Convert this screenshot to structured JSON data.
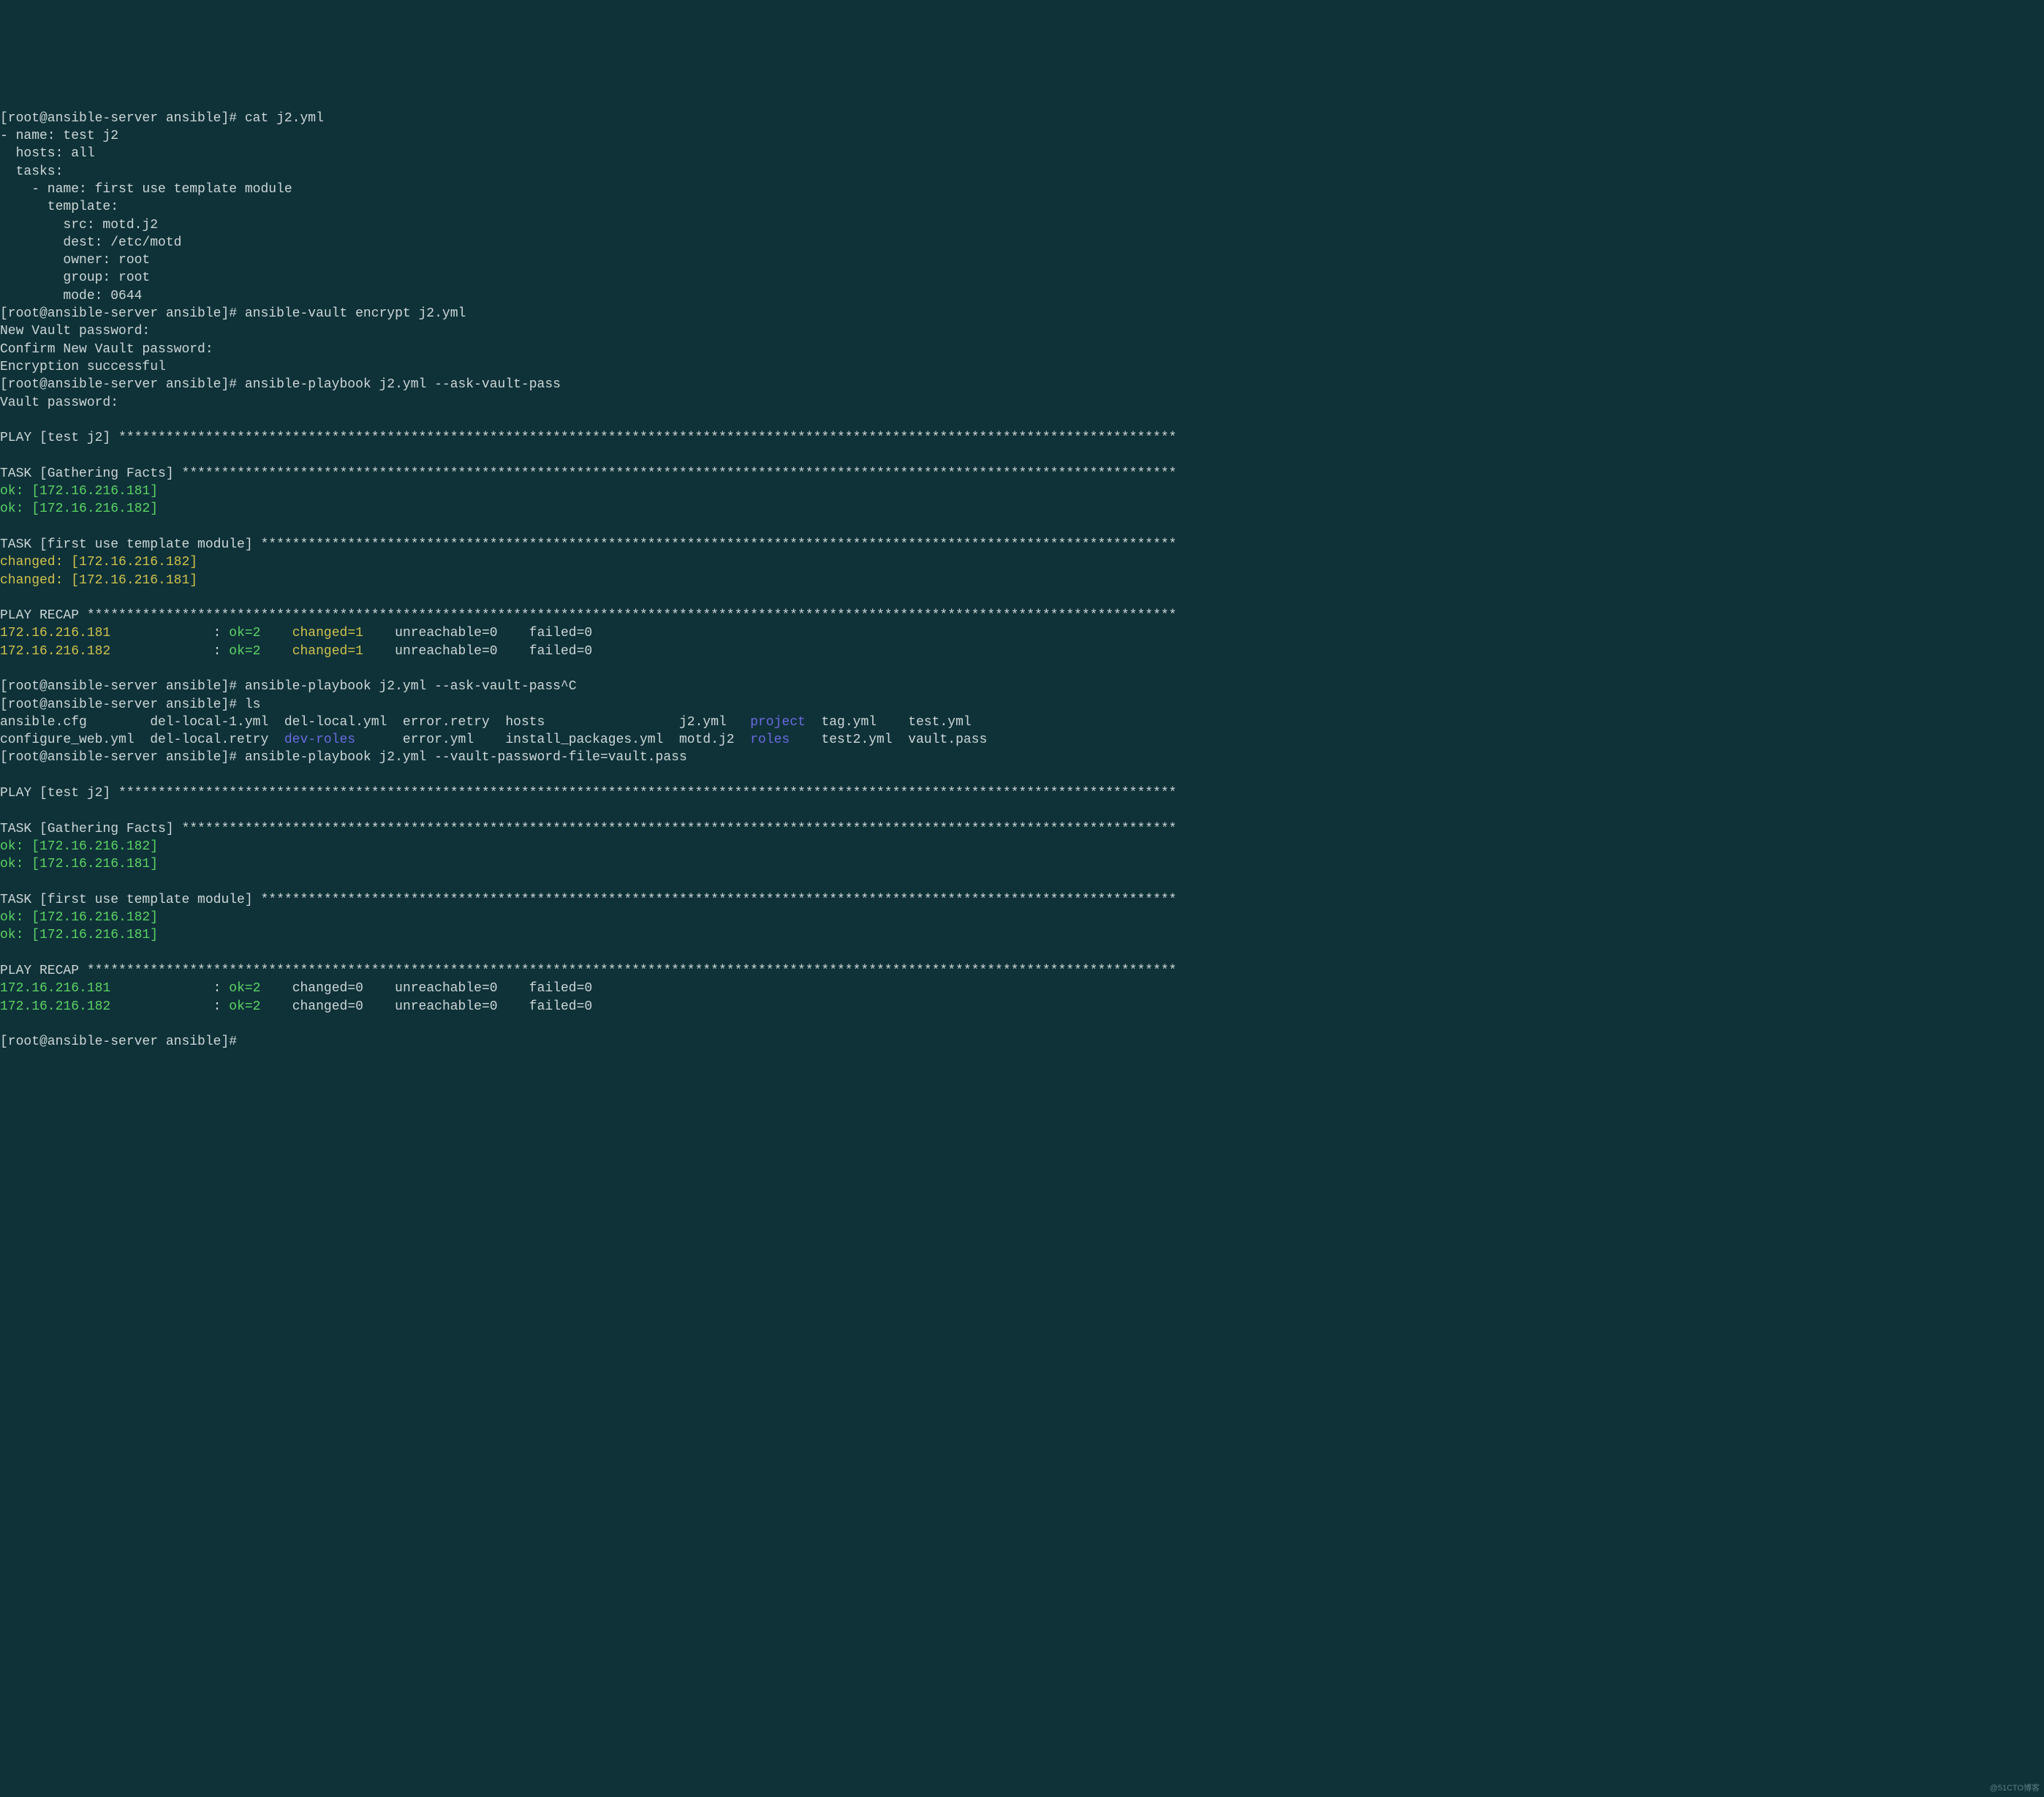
{
  "prompt": "[root@ansible-server ansible]# ",
  "cmd_cat": "cat j2.yml",
  "yml_l1": "- name: test j2",
  "yml_l2": "  hosts: all",
  "yml_l3": "  tasks:",
  "yml_l4": "    - name: first use template module",
  "yml_l5": "      template:",
  "yml_l6": "        src: motd.j2",
  "yml_l7": "        dest: /etc/motd",
  "yml_l8": "        owner: root",
  "yml_l9": "        group: root",
  "yml_l10": "        mode: 0644",
  "cmd_encrypt": "ansible-vault encrypt j2.yml",
  "new_vault_pw": "New Vault password: ",
  "confirm_vault_pw": "Confirm New Vault password: ",
  "enc_success": "Encryption successful",
  "cmd_play_ask": "ansible-playbook j2.yml --ask-vault-pass",
  "vault_pw": "Vault password: ",
  "blank": "",
  "play_test_j2_head": "PLAY [test j2] ",
  "stars_play": "**************************************************************************************************************************************",
  "task_gathering_head": "TASK [Gathering Facts] ",
  "stars_task_g": "******************************************************************************************************************************",
  "ok_181": "ok: [172.16.216.181]",
  "ok_182": "ok: [172.16.216.182]",
  "task_template_head": "TASK [first use template module] ",
  "stars_task_t": "********************************************************************************************************************",
  "changed_182": "changed: [172.16.216.182]",
  "changed_181": "changed: [172.16.216.181]",
  "recap_head": "PLAY RECAP ",
  "stars_recap": "******************************************************************************************************************************************",
  "host_181": "172.16.216.181",
  "host_182": "172.16.216.182",
  "pad_host": "             ",
  "colon_sp": ": ",
  "ok2": "ok=2   ",
  "changed1": " changed=1   ",
  "changed0": " changed=0   ",
  "unreach0": " unreachable=0   ",
  "failed0": " failed=0   ",
  "cmd_play_ask_c": "ansible-playbook j2.yml --ask-vault-pass^C",
  "cmd_ls": "ls",
  "ls_r1_ansiblecfg": "ansible.cfg        ",
  "ls_r1_dellocal1": "del-local-1.yml  ",
  "ls_r1_dellocalyml": "del-local.yml  ",
  "ls_r1_errorretry": "error.retry  ",
  "ls_r1_hosts": "hosts                 ",
  "ls_r1_j2yml": "j2.yml   ",
  "ls_r1_project": "project",
  "ls_r1_sep": "  ",
  "ls_r1_tagyml": "tag.yml    ",
  "ls_r1_testyml": "test.yml",
  "ls_r2_configweb": "configure_web.yml  ",
  "ls_r2_dellocalretry": "del-local.retry  ",
  "ls_r2_devroles": "dev-roles",
  "ls_r2_pad": "      ",
  "ls_r2_erroryml": "error.yml    ",
  "ls_r2_install": "install_packages.yml  ",
  "ls_r2_motdj2": "motd.j2  ",
  "ls_r2_roles": "roles",
  "ls_r2_sep": "    ",
  "ls_r2_test2yml": "test2.yml  ",
  "ls_r2_vaultpass": "vault.pass",
  "cmd_play_file": "ansible-playbook j2.yml --vault-password-file=vault.pass",
  "watermark": "@51CTO博客"
}
